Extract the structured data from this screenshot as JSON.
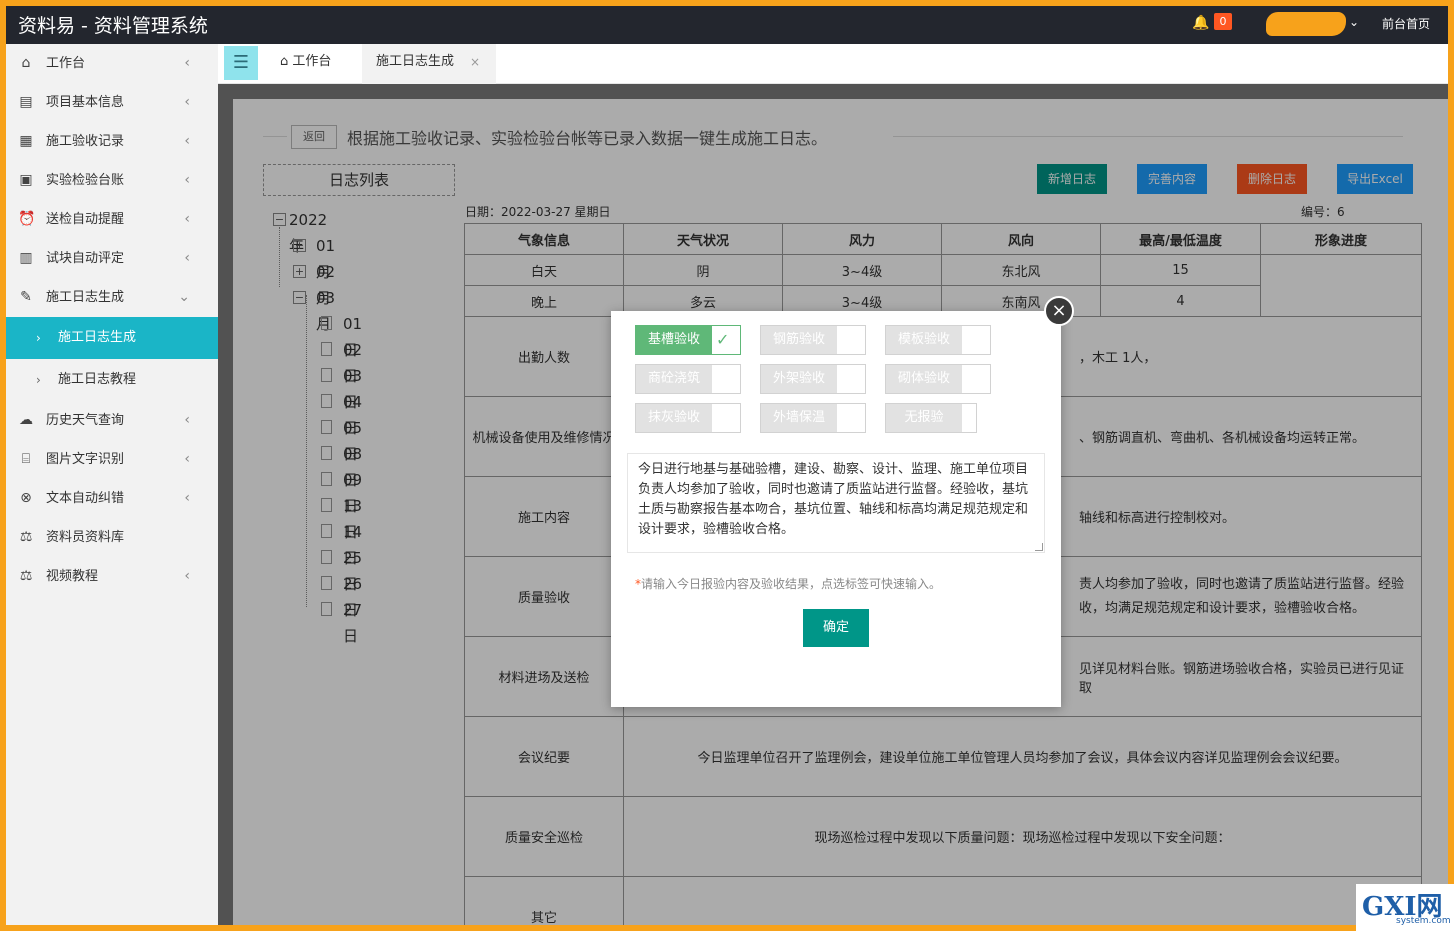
{
  "header": {
    "title": "资料易 - 资料管理系统",
    "notification_count": "0",
    "front_link": "前台首页"
  },
  "sidebar": {
    "items": [
      {
        "label": "工作台",
        "icon": "home-icon"
      },
      {
        "label": "项目基本信息",
        "icon": "doc-icon"
      },
      {
        "label": "施工验收记录",
        "icon": "record-icon"
      },
      {
        "label": "实验检验台账",
        "icon": "ledger-icon"
      },
      {
        "label": "送检自动提醒",
        "icon": "alarm-icon"
      },
      {
        "label": "试块自动评定",
        "icon": "evaluate-icon"
      },
      {
        "label": "施工日志生成",
        "icon": "edit-icon"
      }
    ],
    "sub_items": [
      {
        "label": "施工日志生成",
        "active": true
      },
      {
        "label": "施工日志教程",
        "active": false
      }
    ],
    "items_after": [
      {
        "label": "历史天气查询",
        "icon": "weather-icon"
      },
      {
        "label": "图片文字识别",
        "icon": "ocr-icon"
      },
      {
        "label": "文本自动纠错",
        "icon": "correct-icon"
      },
      {
        "label": "资料员资料库",
        "icon": "scale-icon"
      },
      {
        "label": "视频教程",
        "icon": "scale-icon"
      }
    ]
  },
  "tabs": {
    "home": "工作台",
    "current": "施工日志生成"
  },
  "page": {
    "back": "返回",
    "intro": "根据施工验收记录、实验检验台帐等已录入数据一键生成施工日志。",
    "list_title": "日志列表",
    "year": "2022年",
    "months": [
      "01月",
      "02月",
      "03月"
    ],
    "days": [
      "01日",
      "02日",
      "03日",
      "04日",
      "05日",
      "08日",
      "09日",
      "13日",
      "14日",
      "25日",
      "26日",
      "27日"
    ],
    "buttons": {
      "add": "新增日志",
      "complete": "完善内容",
      "delete": "删除日志",
      "export": "导出Excel"
    },
    "date_label": "日期：2022-03-27 星期日",
    "serial_label": "编号：6"
  },
  "table": {
    "headers": [
      "气象信息",
      "天气状况",
      "风力",
      "风向",
      "最高/最低温度",
      "形象进度"
    ],
    "weather_rows": [
      [
        "白天",
        "阴",
        "3~4级",
        "东北风",
        "15"
      ],
      [
        "晚上",
        "多云",
        "3~4级",
        "东南风",
        "4"
      ]
    ],
    "rows": [
      {
        "label": "出勤人数",
        "value": "，木工 1人，"
      },
      {
        "label": "机械设备使用及维修情况",
        "value": "、钢筋调直机、弯曲机、各机械设备均运转正常。"
      },
      {
        "label": "施工内容",
        "value": "轴线和标高进行控制校对。"
      },
      {
        "label": "质量验收",
        "value": "责人均参加了验收，同时也邀请了质监站进行监督。经验收，均满足规范规定和设计要求，验槽验收合格。"
      },
      {
        "label": "材料进场及送检",
        "value": "见详见材料台账。钢筋进场验收合格，实验员已进行见证取"
      },
      {
        "label": "会议纪要",
        "value": "今日监理单位召开了监理例会，建设单位施工单位管理人员均参加了会议，具体会议内容详见监理例会会议纪要。"
      },
      {
        "label": "质量安全巡检",
        "value": "现场巡检过程中发现以下质量问题：现场巡检过程中发现以下安全问题："
      },
      {
        "label": "其它",
        "value": ""
      }
    ]
  },
  "modal": {
    "tags": [
      {
        "label": "基槽验收",
        "checked": true
      },
      {
        "label": "钢筋验收",
        "checked": false
      },
      {
        "label": "模板验收",
        "checked": false
      },
      {
        "label": "商砼浇筑",
        "checked": false
      },
      {
        "label": "外架验收",
        "checked": false
      },
      {
        "label": "砌体验收",
        "checked": false
      },
      {
        "label": "抹灰验收",
        "checked": false
      },
      {
        "label": "外墙保温",
        "checked": false
      },
      {
        "label": "无报验",
        "checked": false
      }
    ],
    "text": "今日进行地基与基础验槽，建设、勘察、设计、监理、施工单位项目负责人均参加了验收，同时也邀请了质监站进行监督。经验收，基坑土质与勘察报告基本吻合，基坑位置、轴线和标高均满足规范规定和设计要求，验槽验收合格。",
    "hint": "请输入今日报验内容及验收结果，点选标签可快速输入。",
    "confirm": "确定"
  },
  "watermark": {
    "logo": "GXI网",
    "domain": "system.com"
  }
}
